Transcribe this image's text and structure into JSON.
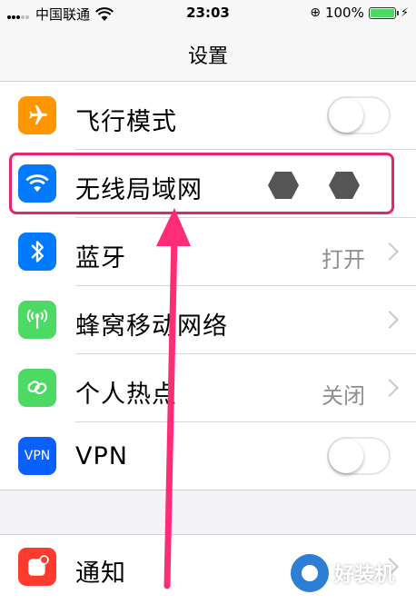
{
  "status_bar": {
    "carrier": "中国联通",
    "time": "23:03",
    "battery_percent": "100%"
  },
  "nav": {
    "title": "设置"
  },
  "rows": [
    {
      "label": "飞行模式",
      "icon": "airplane-icon",
      "icon_color": "#ff9500",
      "toggle": "off"
    },
    {
      "label": "无线局域网",
      "icon": "wifi-icon",
      "icon_color": "#007aff",
      "value": ""
    },
    {
      "label": "蓝牙",
      "icon": "bluetooth-icon",
      "icon_color": "#007aff",
      "value": "打开"
    },
    {
      "label": "蜂窝移动网络",
      "icon": "antenna-icon",
      "icon_color": "#4cd964",
      "value": ""
    },
    {
      "label": "个人热点",
      "icon": "hotspot-icon",
      "icon_color": "#4cd964",
      "value": "关闭"
    },
    {
      "label": "VPN",
      "icon": "vpn-icon",
      "icon_color": "#0a60ff",
      "icon_text": "VPN",
      "toggle": "off"
    }
  ],
  "notifications": {
    "label": "通知",
    "icon": "notification-icon",
    "icon_color": "#ff3b30"
  },
  "annotation": {
    "highlight_color": "#e8246c",
    "arrow_color": "#ff2d78"
  },
  "watermark": {
    "text": "好装机"
  }
}
